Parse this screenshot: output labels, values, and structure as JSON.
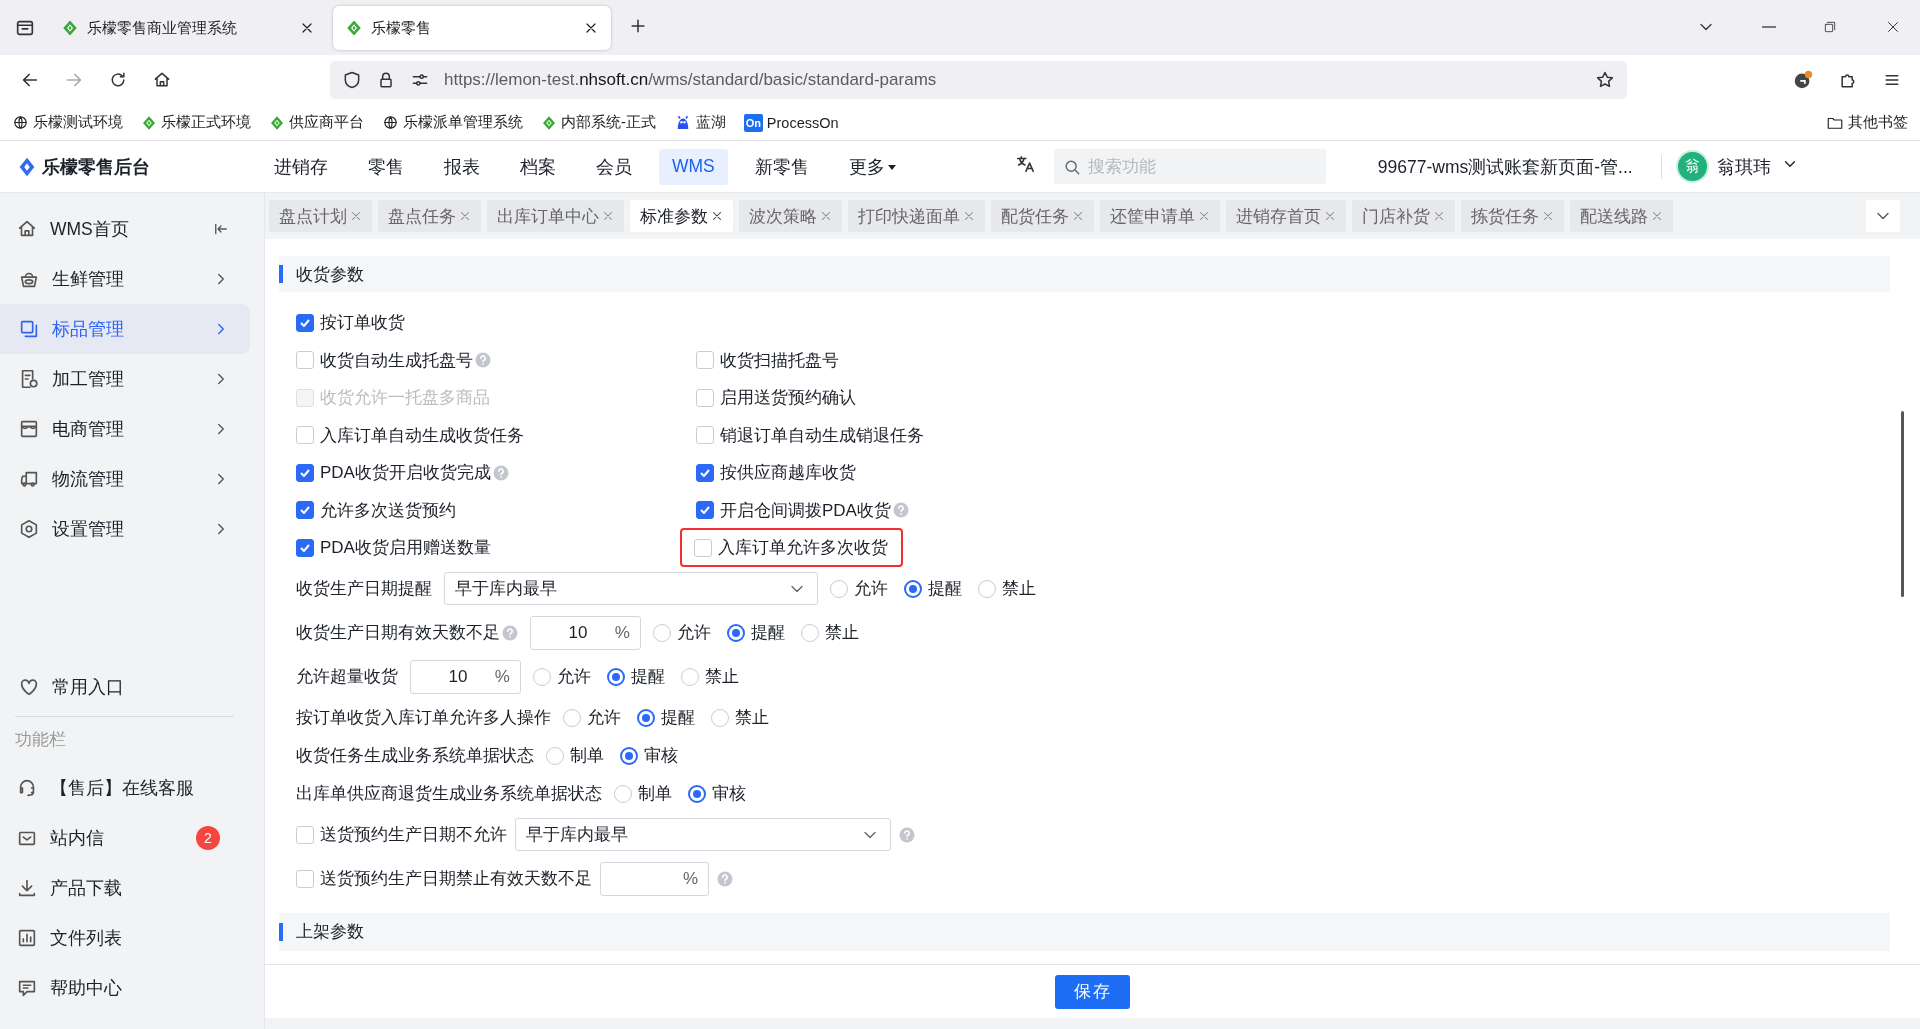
{
  "browser": {
    "tabs": [
      {
        "title": "乐檬零售商业管理系统",
        "selected": false
      },
      {
        "title": "乐檬零售",
        "selected": true
      }
    ],
    "url_prefix": "https://lemon-test.",
    "url_domain": "nhsoft.cn",
    "url_path": "/wms/standard/basic/standard-params",
    "bookmarks": [
      {
        "label": "乐檬测试环境"
      },
      {
        "label": "乐檬正式环境"
      },
      {
        "label": "供应商平台"
      },
      {
        "label": "乐檬派单管理系统"
      },
      {
        "label": "内部系统-正式"
      },
      {
        "label": "蓝湖"
      },
      {
        "label": "ProcessOn",
        "logo_text": "On"
      }
    ],
    "other_bookmarks": "其他书签"
  },
  "app_header": {
    "title": "乐檬零售后台",
    "nav": [
      {
        "label": "进销存",
        "selected": false
      },
      {
        "label": "零售",
        "selected": false
      },
      {
        "label": "报表",
        "selected": false
      },
      {
        "label": "档案",
        "selected": false
      },
      {
        "label": "会员",
        "selected": false
      },
      {
        "label": "WMS",
        "selected": true
      },
      {
        "label": "新零售",
        "selected": false
      },
      {
        "label": "更多",
        "selected": false
      }
    ],
    "search_placeholder": "搜索功能",
    "account": "99677-wms测试账套新页面-管...",
    "avatar_text": "翁",
    "user": "翁琪玮"
  },
  "sidebar": {
    "home": "WMS首页",
    "items": [
      {
        "label": "生鲜管理",
        "selected": false
      },
      {
        "label": "标品管理",
        "selected": true
      },
      {
        "label": "加工管理",
        "selected": false
      },
      {
        "label": "电商管理",
        "selected": false
      },
      {
        "label": "物流管理",
        "selected": false
      },
      {
        "label": "设置管理",
        "selected": false
      }
    ],
    "favorites": "常用入口",
    "tools_title": "功能栏",
    "tools": [
      {
        "label": "【售后】在线客服"
      },
      {
        "label": "站内信",
        "badge": "2"
      },
      {
        "label": "产品下载"
      },
      {
        "label": "文件列表"
      },
      {
        "label": "帮助中心"
      }
    ]
  },
  "page_tabs": [
    {
      "label": "盘点计划",
      "selected": false
    },
    {
      "label": "盘点任务",
      "selected": false
    },
    {
      "label": "出库订单中心",
      "selected": false
    },
    {
      "label": "标准参数",
      "selected": true
    },
    {
      "label": "波次策略",
      "selected": false
    },
    {
      "label": "打印快递面单",
      "selected": false
    },
    {
      "label": "配货任务",
      "selected": false
    },
    {
      "label": "还筐申请单",
      "selected": false
    },
    {
      "label": "进销存首页",
      "selected": false
    },
    {
      "label": "门店补货",
      "selected": false
    },
    {
      "label": "拣货任务",
      "selected": false
    },
    {
      "label": "配送线路",
      "selected": false
    }
  ],
  "receiving": {
    "title": "收货参数",
    "check_rows": [
      {
        "items": [
          {
            "label": "按订单收货",
            "checked": true,
            "disabled": false,
            "help": false,
            "highlighted": false
          }
        ]
      },
      {
        "items": [
          {
            "label": "收货自动生成托盘号",
            "checked": false,
            "disabled": false,
            "help": true,
            "highlighted": false
          },
          {
            "label": "收货扫描托盘号",
            "checked": false,
            "disabled": false,
            "help": false,
            "highlighted": false
          }
        ]
      },
      {
        "items": [
          {
            "label": "收货允许一托盘多商品",
            "checked": false,
            "disabled": true,
            "help": false,
            "highlighted": false
          },
          {
            "label": "启用送货预约确认",
            "checked": false,
            "disabled": false,
            "help": false,
            "highlighted": false
          }
        ]
      },
      {
        "items": [
          {
            "label": "入库订单自动生成收货任务",
            "checked": false,
            "disabled": false,
            "help": false,
            "highlighted": false
          },
          {
            "label": "销退订单自动生成销退任务",
            "checked": false,
            "disabled": false,
            "help": false,
            "highlighted": false
          }
        ]
      },
      {
        "items": [
          {
            "label": "PDA收货开启收货完成",
            "checked": true,
            "disabled": false,
            "help": true,
            "highlighted": false
          },
          {
            "label": "按供应商越库收货",
            "checked": true,
            "disabled": false,
            "help": false,
            "highlighted": false
          }
        ]
      },
      {
        "items": [
          {
            "label": "允许多次送货预约",
            "checked": true,
            "disabled": false,
            "help": false,
            "highlighted": false
          },
          {
            "label": "开启仓间调拨PDA收货",
            "checked": true,
            "disabled": false,
            "help": true,
            "highlighted": false
          }
        ]
      },
      {
        "items": [
          {
            "label": "PDA收货启用赠送数量",
            "checked": true,
            "disabled": false,
            "help": false,
            "highlighted": false
          },
          {
            "label": "入库订单允许多次收货",
            "checked": false,
            "disabled": false,
            "help": false,
            "highlighted": true
          }
        ]
      }
    ],
    "settings": [
      {
        "kind": "select-radio",
        "label": "收货生产日期提醒",
        "help": false,
        "value": "早于库内最早",
        "options": [
          {
            "label": "允许",
            "selected": false
          },
          {
            "label": "提醒",
            "selected": true
          },
          {
            "label": "禁止",
            "selected": false
          }
        ]
      },
      {
        "kind": "input-radio",
        "label": "收货生产日期有效天数不足",
        "help": true,
        "value": "10",
        "unit": "%",
        "options": [
          {
            "label": "允许",
            "selected": false
          },
          {
            "label": "提醒",
            "selected": true
          },
          {
            "label": "禁止",
            "selected": false
          }
        ]
      },
      {
        "kind": "input-radio",
        "label": "允许超量收货",
        "help": false,
        "value": "10",
        "unit": "%",
        "options": [
          {
            "label": "允许",
            "selected": false
          },
          {
            "label": "提醒",
            "selected": true
          },
          {
            "label": "禁止",
            "selected": false
          }
        ]
      },
      {
        "kind": "radio",
        "label": "按订单收货入库订单允许多人操作",
        "help": false,
        "options": [
          {
            "label": "允许",
            "selected": false
          },
          {
            "label": "提醒",
            "selected": true
          },
          {
            "label": "禁止",
            "selected": false
          }
        ]
      },
      {
        "kind": "radio",
        "label": "收货任务生成业务系统单据状态",
        "help": false,
        "options": [
          {
            "label": "制单",
            "selected": false
          },
          {
            "label": "审核",
            "selected": true
          }
        ]
      },
      {
        "kind": "radio",
        "label": "出库单供应商退货生成业务系统单据状态",
        "help": false,
        "options": [
          {
            "label": "制单",
            "selected": false
          },
          {
            "label": "审核",
            "selected": true
          }
        ]
      },
      {
        "kind": "checkbox-select",
        "label": "送货预约生产日期不允许",
        "checked": false,
        "help": true,
        "value": "早于库内最早"
      },
      {
        "kind": "checkbox-input",
        "label": "送货预约生产日期禁止有效天数不足",
        "checked": false,
        "help": true,
        "unit": "%"
      }
    ]
  },
  "shelving": {
    "title": "上架参数"
  },
  "footer": {
    "save": "保存"
  }
}
